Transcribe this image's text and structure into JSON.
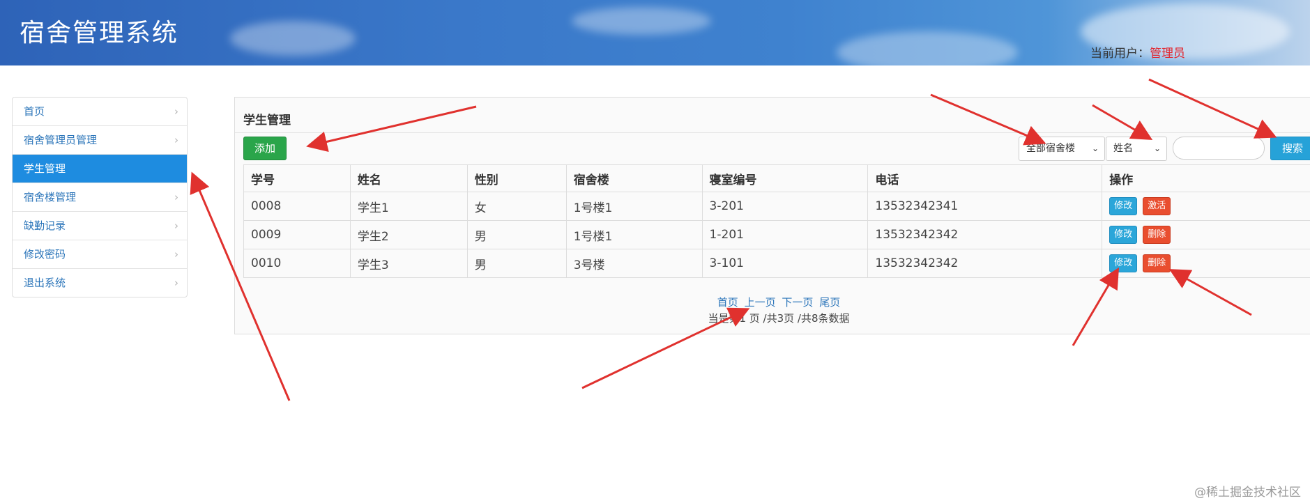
{
  "header": {
    "title": "宿舍管理系统",
    "user_label": "当前用户：",
    "user_role": "管理员"
  },
  "sidebar": {
    "items": [
      {
        "label": "首页",
        "active": false
      },
      {
        "label": "宿舍管理员管理",
        "active": false
      },
      {
        "label": "学生管理",
        "active": true
      },
      {
        "label": "宿舍楼管理",
        "active": false
      },
      {
        "label": "缺勤记录",
        "active": false
      },
      {
        "label": "修改密码",
        "active": false
      },
      {
        "label": "退出系统",
        "active": false
      }
    ]
  },
  "panel": {
    "title": "学生管理",
    "add_label": "添加",
    "building_select": "全部宿舍楼",
    "field_select": "姓名",
    "search_value": "",
    "search_label": "搜索"
  },
  "table": {
    "headers": [
      "学号",
      "姓名",
      "性别",
      "宿舍楼",
      "寝室编号",
      "电话",
      "操作"
    ],
    "rows": [
      {
        "id": "0008",
        "name": "学生1",
        "gender": "女",
        "building": "1号楼1",
        "room": "3-201",
        "phone": "13532342341",
        "edit": "修改",
        "action": "激活"
      },
      {
        "id": "0009",
        "name": "学生2",
        "gender": "男",
        "building": "1号楼1",
        "room": "1-201",
        "phone": "13532342342",
        "edit": "修改",
        "action": "删除"
      },
      {
        "id": "0010",
        "name": "学生3",
        "gender": "男",
        "building": "3号楼",
        "room": "3-101",
        "phone": "13532342342",
        "edit": "修改",
        "action": "删除"
      }
    ]
  },
  "pager": {
    "first": "首页",
    "prev": "上一页",
    "next": "下一页",
    "last": "尾页",
    "info": "当是第1 页 /共3页  /共8条数据"
  },
  "watermark": "@稀土掘金技术社区",
  "colors": {
    "header": "#3a78c9",
    "active": "#1e8ce0",
    "add": "#2aa54a",
    "search": "#26a2d8",
    "edit": "#2ba6d9",
    "delete": "#e94e2f",
    "annotation": "#e0312e"
  }
}
